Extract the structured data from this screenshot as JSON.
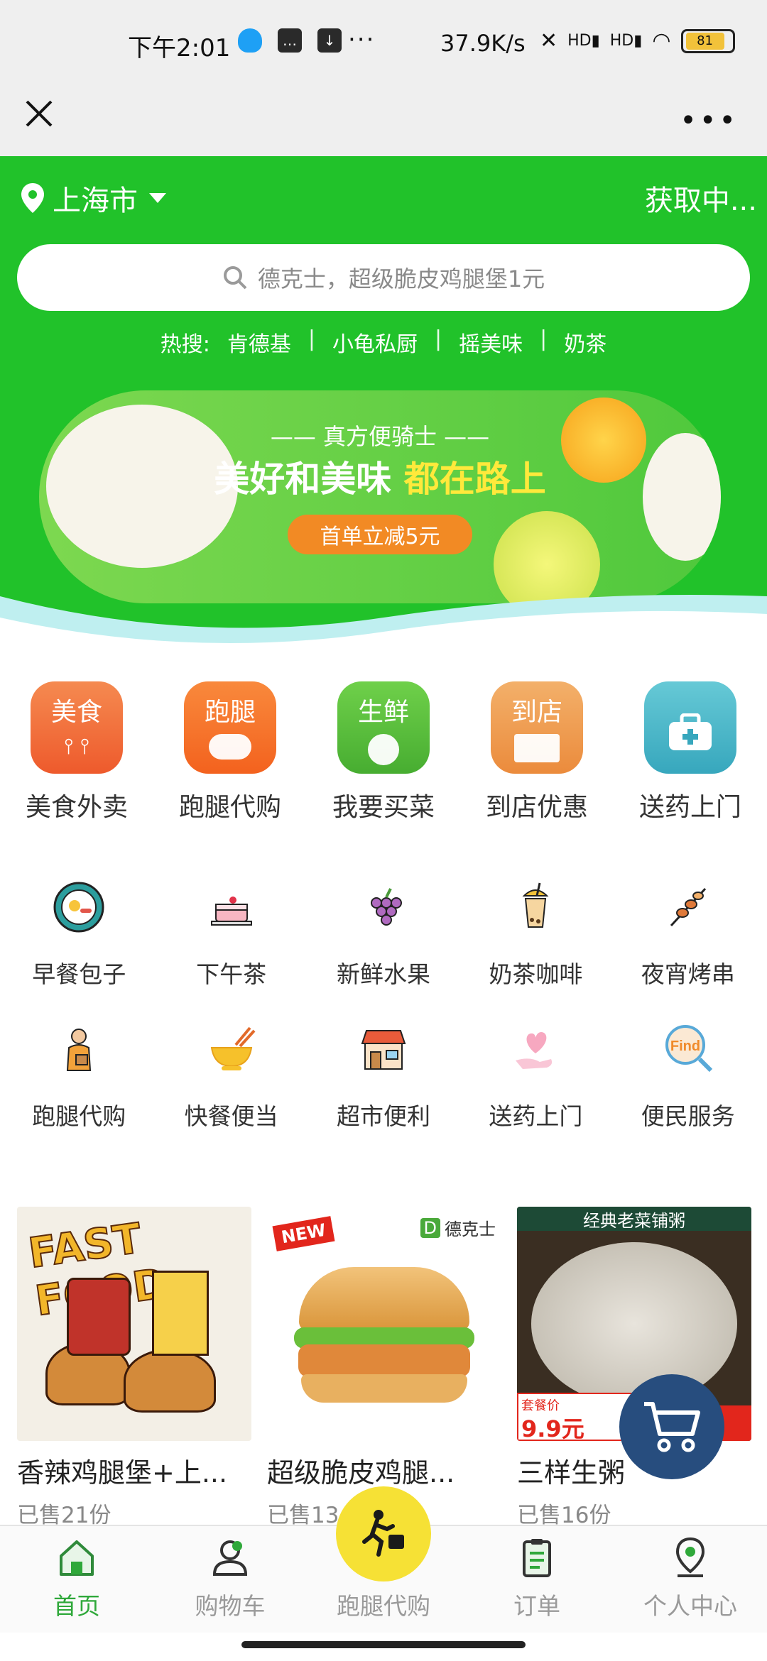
{
  "status_bar": {
    "time": "下午2:01",
    "icons": [
      "qq-icon",
      "message-icon",
      "download-icon"
    ],
    "more": "···",
    "network_speed": "37.9K/s",
    "signal_left": "HD",
    "signal_right": "HD",
    "battery": "81"
  },
  "navbar": {
    "more": "•••"
  },
  "header": {
    "city": "上海市",
    "location_status": "获取中...",
    "search_placeholder": "德克士，超级脆皮鸡腿堡1元",
    "hot_label": "热搜:",
    "hot_terms": [
      "肯德基",
      "小龟私厨",
      "摇美味",
      "奶茶"
    ],
    "separator": "|"
  },
  "banner": {
    "subtitle": "—— 真方便骑士 ——",
    "title_main": "美好和美味",
    "title_highlight": "都在路上",
    "cta": "首单立减5元"
  },
  "main_categories": [
    {
      "icon_text": "美食",
      "label": "美食外卖",
      "color": "#f06a3a"
    },
    {
      "icon_text": "跑腿",
      "label": "跑腿代购",
      "color": "#f7732b"
    },
    {
      "icon_text": "生鲜",
      "label": "我要买菜",
      "color": "#5cbf3f"
    },
    {
      "icon_text": "到店",
      "label": "到店优惠",
      "color": "#ef9a4a"
    },
    {
      "icon_text": "",
      "label": "送药上门",
      "color": "#4ab7c8"
    }
  ],
  "sub_categories_row1": [
    {
      "label": "早餐包子",
      "icon": "breakfast-icon"
    },
    {
      "label": "下午茶",
      "icon": "cake-icon"
    },
    {
      "label": "新鲜水果",
      "icon": "grapes-icon"
    },
    {
      "label": "奶茶咖啡",
      "icon": "bubble-tea-icon"
    },
    {
      "label": "夜宵烤串",
      "icon": "skewer-icon"
    }
  ],
  "sub_categories_row2": [
    {
      "label": "跑腿代购",
      "icon": "courier-icon"
    },
    {
      "label": "快餐便当",
      "icon": "bowl-icon"
    },
    {
      "label": "超市便利",
      "icon": "store-icon"
    },
    {
      "label": "送药上门",
      "icon": "heart-hand-icon"
    },
    {
      "label": "便民服务",
      "icon": "find-icon"
    }
  ],
  "products": [
    {
      "title": "香辣鸡腿堡+上...",
      "sold": "已售21份",
      "image_text": "FAST FOOD"
    },
    {
      "title": "超级脆皮鸡腿...",
      "sold": "已售13",
      "image_text": "德克士",
      "badge": "NEW"
    },
    {
      "title": "三样生粥",
      "sold": "已售16份",
      "image_text": "经典老菜铺粥",
      "price_label": "套餐价",
      "price": "9.9元"
    }
  ],
  "tabbar": [
    {
      "label": "首页",
      "icon": "home-icon",
      "active": true
    },
    {
      "label": "购物车",
      "icon": "cart-user-icon",
      "active": false
    },
    {
      "label": "跑腿代购",
      "icon": "runner-icon",
      "active": false
    },
    {
      "label": "订单",
      "icon": "clipboard-icon",
      "active": false
    },
    {
      "label": "个人中心",
      "icon": "location-user-icon",
      "active": false
    }
  ]
}
